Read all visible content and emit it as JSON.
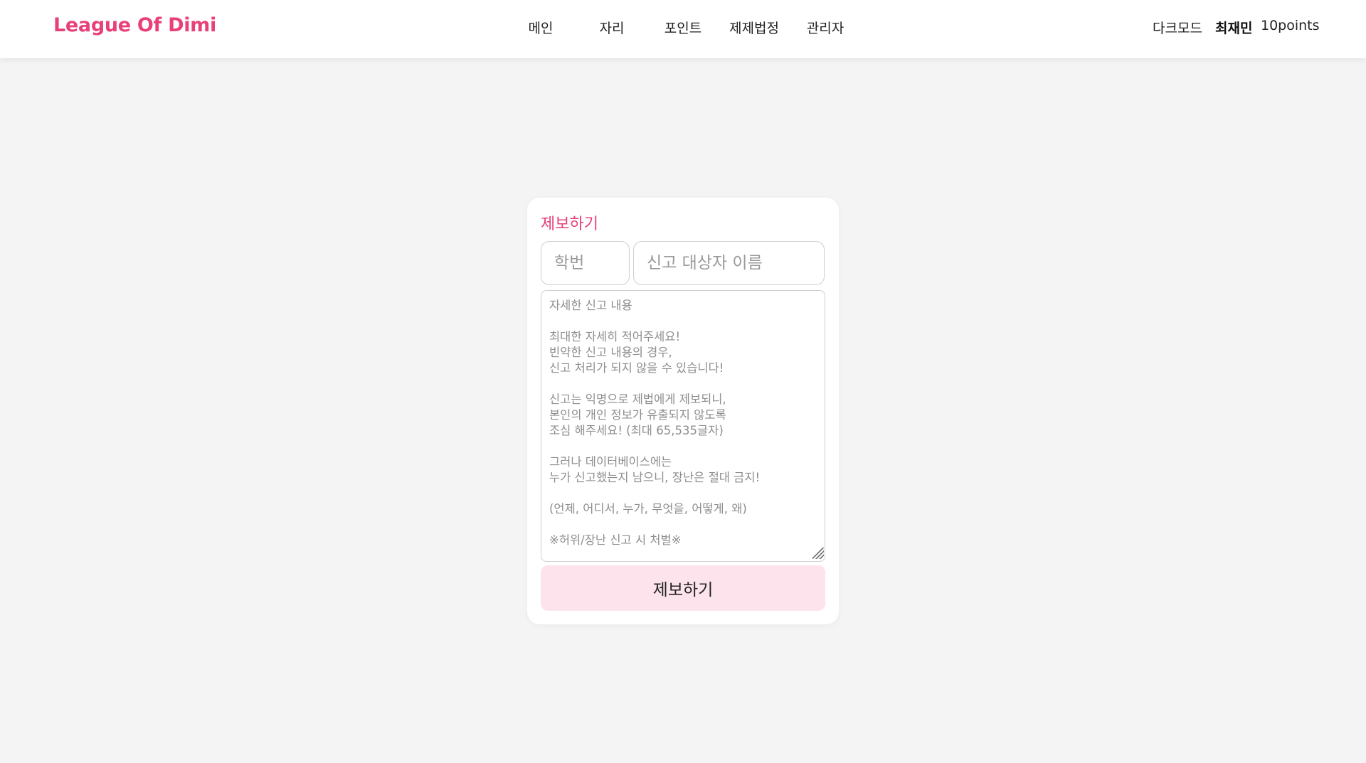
{
  "header": {
    "logo": "League Of Dimi",
    "nav": [
      {
        "label": "메인"
      },
      {
        "label": "자리"
      },
      {
        "label": "포인트"
      },
      {
        "label": "제제법정"
      },
      {
        "label": "관리자"
      }
    ],
    "dark_mode": "다크모드",
    "user_name": "최재민",
    "points": "10points"
  },
  "report_form": {
    "title": "제보하기",
    "student_id_placeholder": "학번",
    "target_name_placeholder": "신고 대상자 이름",
    "details_placeholder": "자세한 신고 내용\n\n최대한 자세히 적어주세요!\n빈약한 신고 내용의 경우,\n신고 처리가 되지 않을 수 있습니다!\n\n신고는 익명으로 제법에게 제보되니,\n본인의 개인 정보가 유출되지 않도록\n조심 해주세요! (최대 65,535글자)\n\n그러나 데이터베이스에는\n누가 신고했는지 남으니, 장난은 절대 금지!\n\n(언제, 어디서, 누가, 무엇을, 어떻게, 왜)\n\n※허위/장난 신고 시 처벌※",
    "submit_label": "제보하기"
  },
  "colors": {
    "accent": "#e8407a",
    "button_bg": "#fde4ec",
    "page_bg": "#f4f4f4"
  }
}
